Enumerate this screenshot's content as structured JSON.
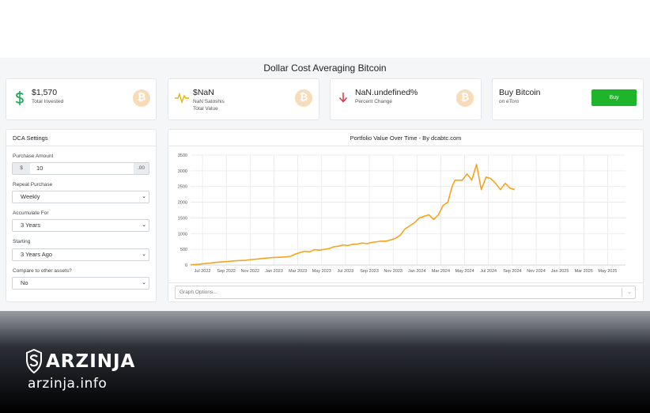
{
  "page_title": "Dollar Cost Averaging Bitcoin",
  "stats": [
    {
      "value": "$1,570",
      "sub": "Total Invested",
      "icon": "dollar-icon"
    },
    {
      "value": "$NaN",
      "sub": "NaN Satoshis",
      "sub2": "Total Value",
      "icon": "pulse-icon"
    },
    {
      "value": "NaN.undefined%",
      "sub": "Percent Change",
      "icon": "arrow-down-icon"
    }
  ],
  "coin_glyph": "₿",
  "buy": {
    "title": "Buy Bitcoin",
    "subtitle": "on eToro",
    "button_label": "Buy"
  },
  "settings": {
    "title": "DCA Settings",
    "purchase_amount_label": "Purchase Amount",
    "purchase_amount_prefix": "$",
    "purchase_amount_value": "10",
    "purchase_amount_suffix": ".00",
    "repeat_label": "Repeat Purchase",
    "repeat_value": "Weekly",
    "accumulate_label": "Accumulate For",
    "accumulate_value": "3 Years",
    "starting_label": "Starting",
    "starting_value": "3 Years Ago",
    "compare_label": "Compare to other assets?",
    "compare_value": "No"
  },
  "graph_options_placeholder": "Graph Options...",
  "colors": {
    "line": "#f7a31c",
    "buy_button": "#1fb52b",
    "grid": "#e8e8e8"
  },
  "chart_data": {
    "type": "line",
    "title": "Portfolio Value Over Time - By dcabtc.com",
    "ylim": [
      0,
      3500
    ],
    "yticks": [
      0,
      500,
      1000,
      1500,
      2000,
      2500,
      3000,
      3500
    ],
    "x_ticks": [
      "Jul 2022",
      "Sep 2022",
      "Nov 2022",
      "Jan 2023",
      "Mar 2023",
      "May 2023",
      "Jul 2023",
      "Sep 2023",
      "Nov 2023",
      "Jan 2024",
      "Mar 2024",
      "May 2024",
      "Jul 2024",
      "Sep 2024",
      "Nov 2024",
      "Jan 2025",
      "Mar 2025",
      "May 2025"
    ],
    "grid": true,
    "series": [
      {
        "x": [
          0,
          0.3,
          0.5,
          0.8,
          1.0,
          1.3,
          1.5,
          1.8,
          2.0,
          2.3,
          2.5,
          2.8,
          3.0,
          3.3,
          3.5,
          3.8,
          4.0,
          4.2,
          4.4,
          4.6,
          4.8,
          5.0,
          5.2,
          5.4,
          5.6,
          5.8,
          6.0,
          6.2,
          6.4,
          6.6,
          6.8,
          7.0,
          7.2,
          7.4,
          7.6,
          7.8,
          8.0,
          8.2,
          8.4,
          8.6,
          8.8,
          9.0,
          9.2,
          9.4,
          9.6,
          9.8,
          10.0,
          10.2,
          10.4,
          10.6,
          10.8,
          10.9,
          11.0,
          11.1,
          11.2,
          11.4,
          11.6,
          11.8,
          12.0,
          12.2,
          12.4,
          12.6,
          12.8,
          13.0,
          13.2,
          13.4,
          13.6
        ],
        "values": [
          10,
          20,
          40,
          60,
          80,
          100,
          110,
          130,
          140,
          150,
          170,
          190,
          210,
          230,
          240,
          250,
          260,
          280,
          350,
          400,
          440,
          420,
          490,
          470,
          500,
          520,
          580,
          600,
          640,
          620,
          660,
          670,
          700,
          680,
          720,
          740,
          760,
          760,
          800,
          850,
          950,
          1150,
          1250,
          1350,
          1500,
          1550,
          1600,
          1450,
          1600,
          1900,
          2000,
          2300,
          2550,
          2700,
          2700,
          2700,
          2900,
          2700,
          3200,
          2400,
          2800,
          2750,
          2600,
          2400,
          2600,
          2450,
          2400
        ]
      }
    ]
  }
}
